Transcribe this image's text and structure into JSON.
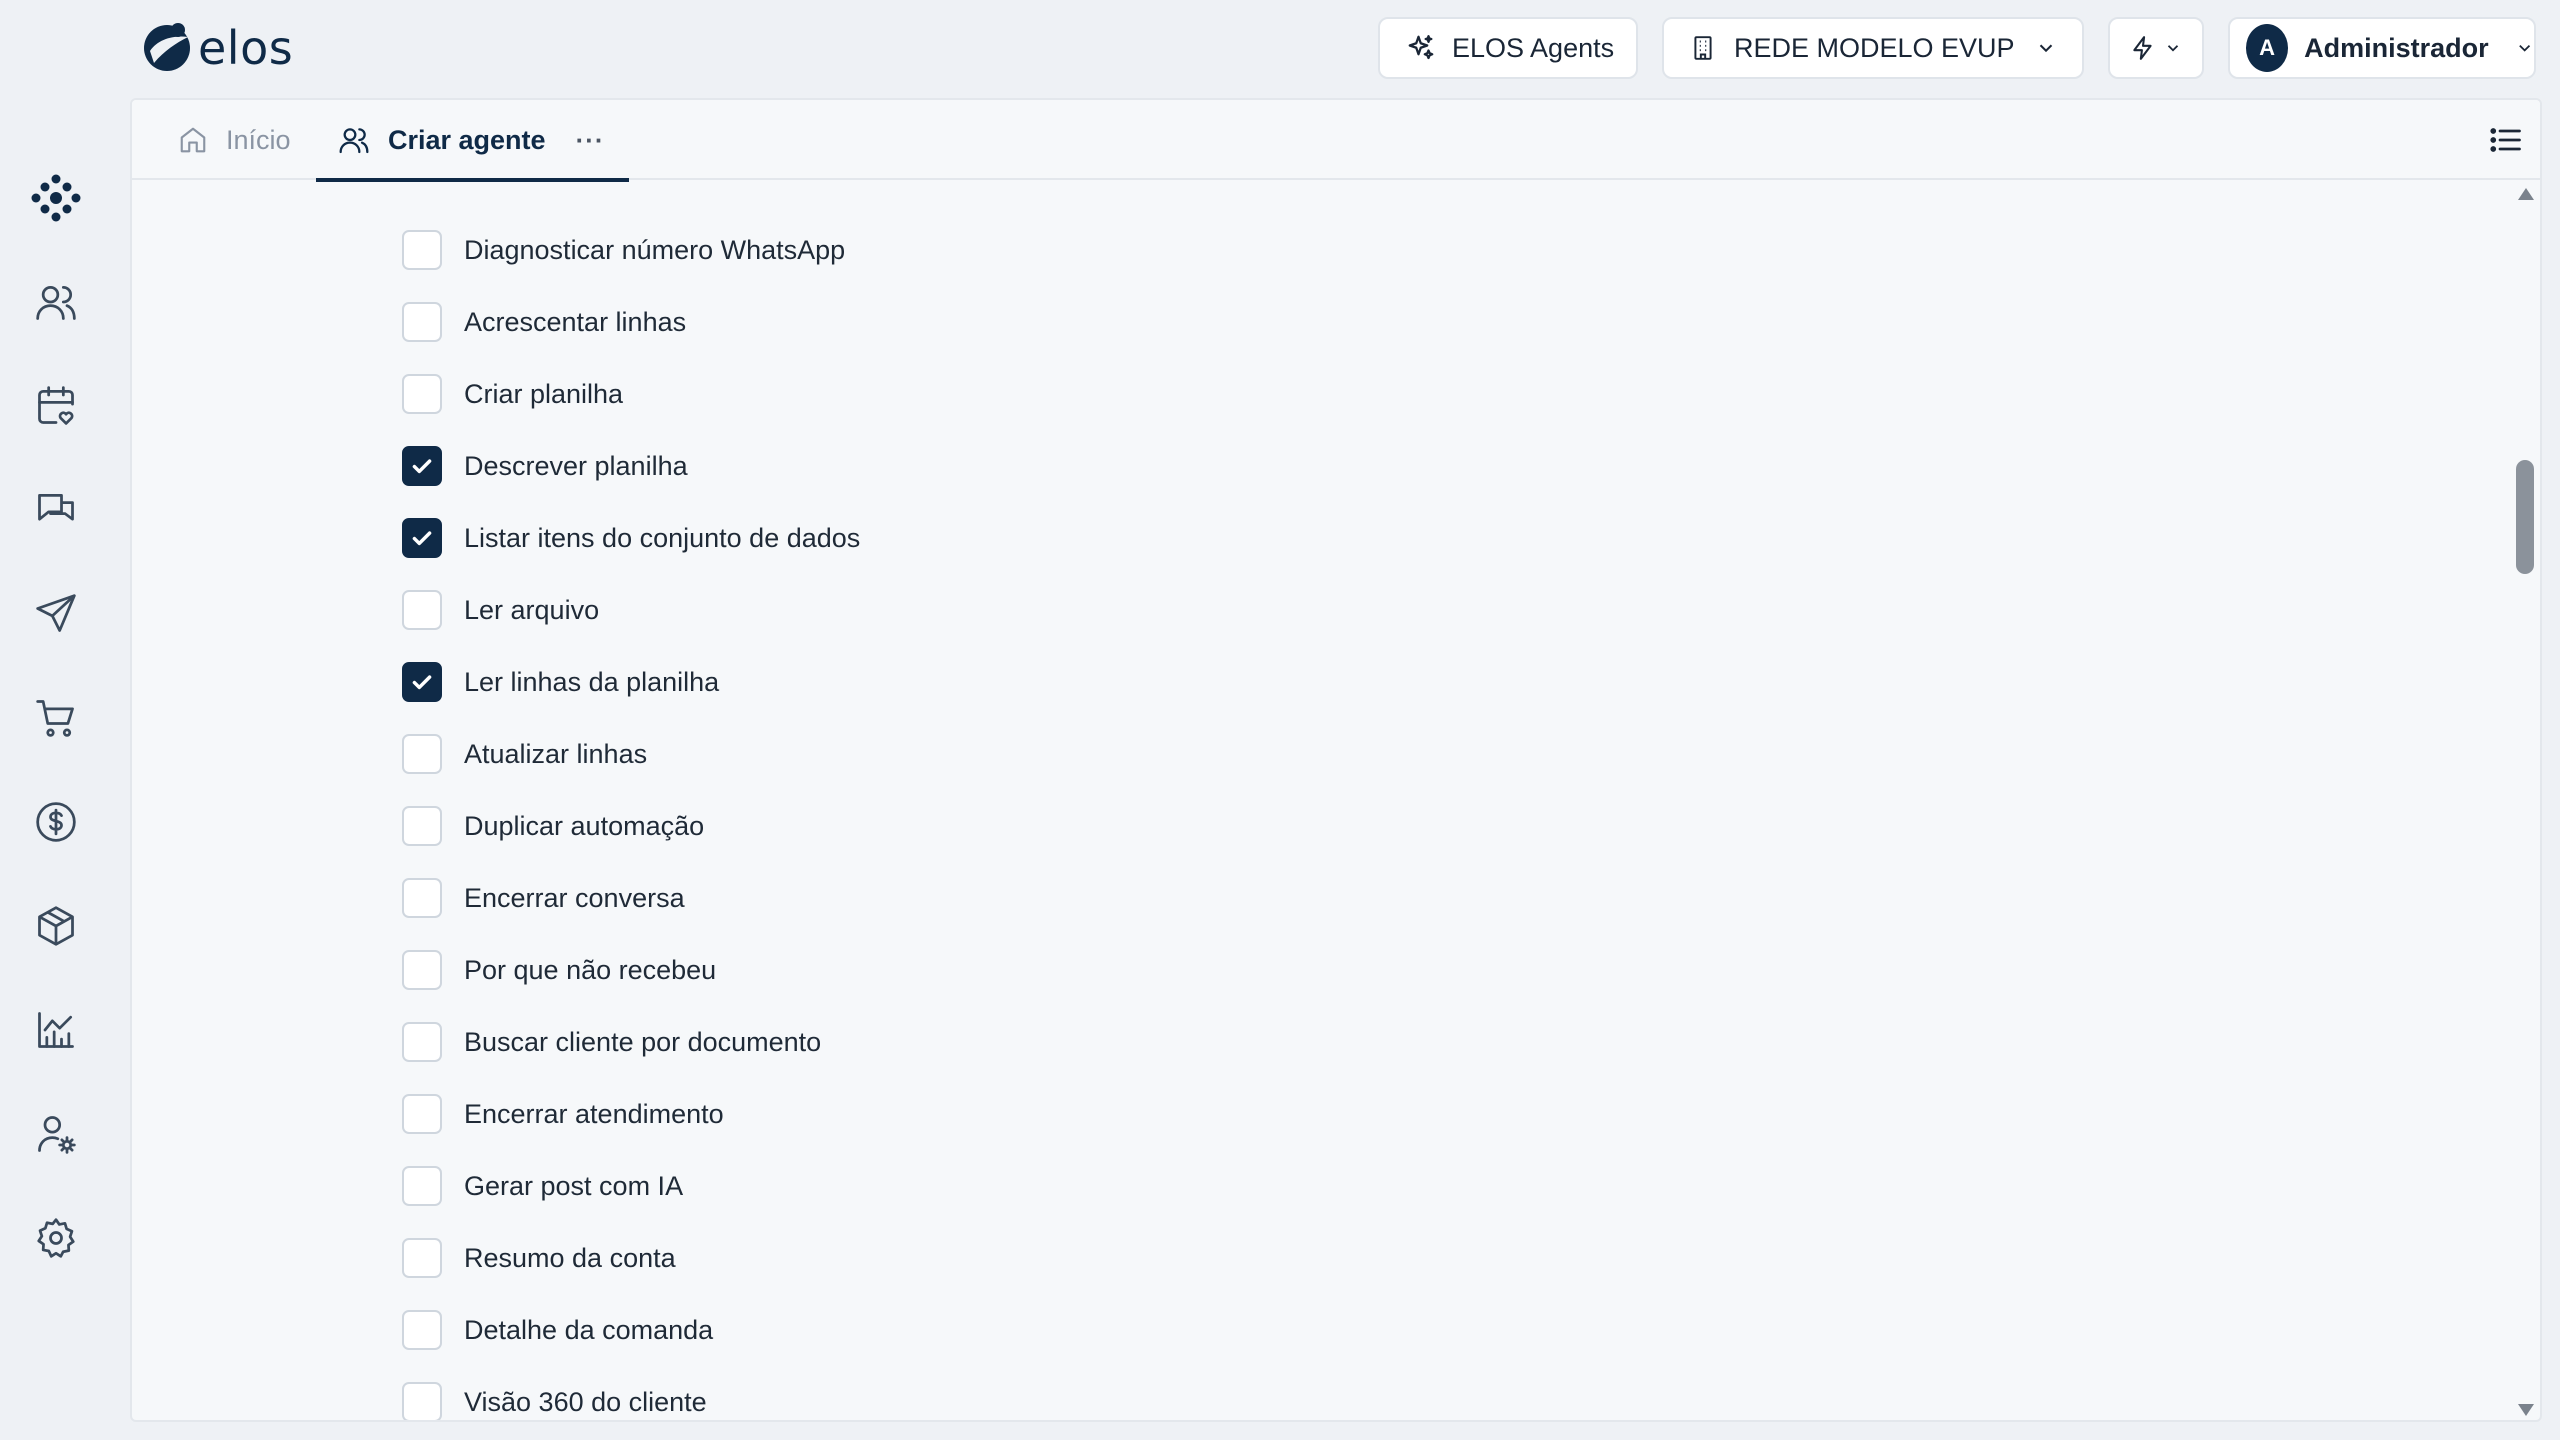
{
  "brand": {
    "logo_text": "elos"
  },
  "header": {
    "agents_label": "ELOS Agents",
    "network_label": "REDE MODELO EVUP",
    "user_initial": "A",
    "user_label": "Administrador"
  },
  "sidebar": {
    "items": [
      {
        "icon": "apps-dots-icon"
      },
      {
        "icon": "users-icon"
      },
      {
        "icon": "calendar-heart-icon"
      },
      {
        "icon": "chat-icon"
      },
      {
        "icon": "send-icon"
      },
      {
        "icon": "cart-icon"
      },
      {
        "icon": "dollar-icon"
      },
      {
        "icon": "package-icon"
      },
      {
        "icon": "chart-icon"
      },
      {
        "icon": "user-settings-icon"
      },
      {
        "icon": "settings-icon"
      }
    ]
  },
  "tabs": {
    "home_label": "Início",
    "active_label": "Criar agente",
    "more_label": "···"
  },
  "tools": [
    {
      "label": "Diagnosticar número WhatsApp",
      "checked": false
    },
    {
      "label": "Acrescentar linhas",
      "checked": false
    },
    {
      "label": "Criar planilha",
      "checked": false
    },
    {
      "label": "Descrever planilha",
      "checked": true
    },
    {
      "label": "Listar itens do conjunto de dados",
      "checked": true
    },
    {
      "label": "Ler arquivo",
      "checked": false
    },
    {
      "label": "Ler linhas da planilha",
      "checked": true
    },
    {
      "label": "Atualizar linhas",
      "checked": false
    },
    {
      "label": "Duplicar automação",
      "checked": false
    },
    {
      "label": "Encerrar conversa",
      "checked": false
    },
    {
      "label": "Por que não recebeu",
      "checked": false
    },
    {
      "label": "Buscar cliente por documento",
      "checked": false
    },
    {
      "label": "Encerrar atendimento",
      "checked": false
    },
    {
      "label": "Gerar post com IA",
      "checked": false
    },
    {
      "label": "Resumo da conta",
      "checked": false
    },
    {
      "label": "Detalhe da comanda",
      "checked": false
    },
    {
      "label": "Visão 360 do cliente",
      "checked": false
    }
  ],
  "colors": {
    "brand_navy": "#0f2a47",
    "background": "#eef1f5",
    "panel": "#f6f8fa"
  }
}
